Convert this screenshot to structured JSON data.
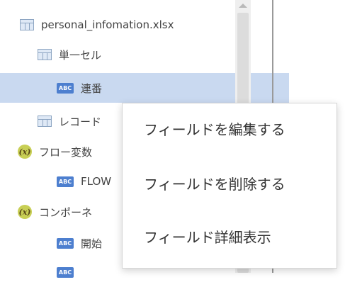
{
  "tree": {
    "items": [
      {
        "icon": "table-icon",
        "label": "personal_infomation.xlsx"
      },
      {
        "icon": "table-icon",
        "label": "単一セル"
      },
      {
        "icon": "abc-icon",
        "icon_text": "ABC",
        "label": "連番",
        "selected": true
      },
      {
        "icon": "table-icon",
        "label": "レコード"
      },
      {
        "icon": "variable-icon",
        "icon_text": "(x)",
        "label": "フロー変数"
      },
      {
        "icon": "abc-icon",
        "icon_text": "ABC",
        "label": "FLOW"
      },
      {
        "icon": "variable-icon",
        "icon_text": "(x)",
        "label": "コンポーネ"
      },
      {
        "icon": "abc-icon",
        "icon_text": "ABC",
        "label": "開始"
      },
      {
        "icon": "abc-icon",
        "icon_text": "ABC",
        "label": ""
      }
    ]
  },
  "context_menu": {
    "items": [
      {
        "label": "フィールドを編集する"
      },
      {
        "label": "フィールドを削除する"
      },
      {
        "label": "フィールド詳細表示"
      }
    ]
  },
  "colors": {
    "selection": "#c9d9f0",
    "abc_icon": "#4d7fcf",
    "variable_icon": "#c8cf55"
  }
}
